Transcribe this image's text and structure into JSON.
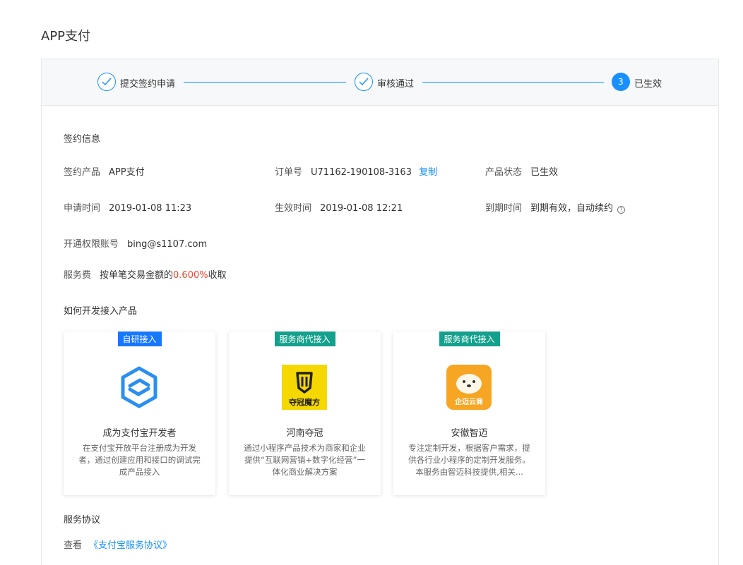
{
  "page_title": "APP支付",
  "steps": [
    {
      "label": "提交签约申请",
      "status": "done"
    },
    {
      "label": "审核通过",
      "status": "done"
    },
    {
      "label": "已生效",
      "status": "current",
      "number": "3"
    }
  ],
  "contract": {
    "section_title": "签约信息",
    "product_label": "签约产品",
    "product_value": "APP支付",
    "order_label": "订单号",
    "order_value": "U71162-190108-3163",
    "copy_label": "复制",
    "status_label": "产品状态",
    "status_value": "已生效",
    "apply_time_label": "申请时间",
    "apply_time_value": "2019-01-08 11:23",
    "effective_time_label": "生效时间",
    "effective_time_value": "2019-01-08 12:21",
    "expire_label": "到期时间",
    "expire_value": "到期有效，自动续约",
    "account_label": "开通权限账号",
    "account_value": "bing@s1107.com",
    "fee_label": "服务费",
    "fee_prefix": "按单笔交易金额的",
    "fee_rate": "0.600%",
    "fee_suffix": "收取"
  },
  "integration": {
    "section_title": "如何开发接入产品",
    "cards": [
      {
        "tag": "自研接入",
        "tag_color": "#1677ff",
        "name": "成为支付宝开发者",
        "desc": "在支付宝开放平台注册成为开发者，通过创建应用和接口的调试完成产品接入",
        "logo": "alipay-developer-icon"
      },
      {
        "tag": "服务商代接入",
        "tag_color": "#13a08c",
        "name": "河南夺冠",
        "desc": "通过小程序产品技术为商家和企业提供“互联网营销+数字化经营”一体化商业解决方案",
        "logo": "duoguan-logo",
        "logo_text": "夺冠魔方"
      },
      {
        "tag": "服务商代接入",
        "tag_color": "#13a08c",
        "name": "安徽智迈",
        "desc": "专注定制开发，根据客户需求，提供各行业小程序的定制开发服务。本服务由智迈科技提供,相关...",
        "logo": "zhimai-logo",
        "logo_text": "企迈云商"
      }
    ]
  },
  "protocol": {
    "section_title": "服务协议",
    "view_label": "查看",
    "link_label": "《支付宝服务协议》"
  },
  "colors": {
    "accent": "#1890ff",
    "status_red": "#f5452c"
  }
}
